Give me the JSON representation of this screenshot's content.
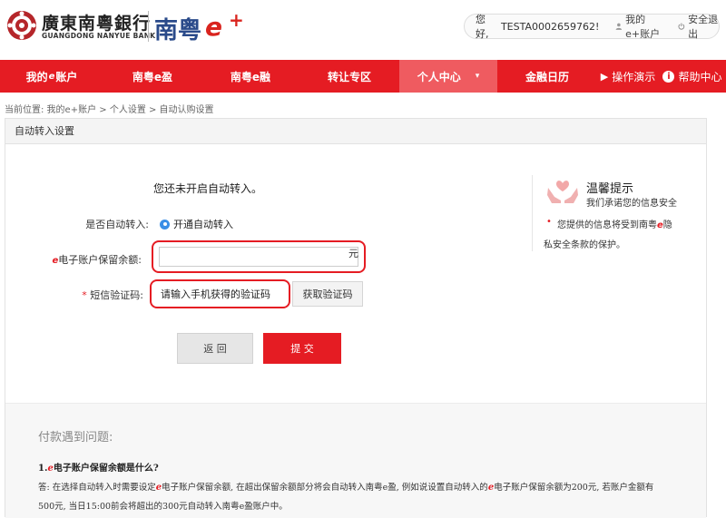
{
  "header": {
    "bank_name_cn": "廣東南粵銀行",
    "bank_name_en": "GUANGDONG NANYUE BANK",
    "brand_cn": "南粤",
    "brand_e": "e",
    "brand_plus": "+",
    "greeting": "您好,",
    "user_id": "TESTA0002659762!",
    "my_account": "我的e+账户",
    "logout": "安全退出"
  },
  "nav": {
    "items": [
      {
        "label": "我的",
        "suffix": "账户"
      },
      {
        "label": "南粤e盈"
      },
      {
        "label": "南粤e融"
      },
      {
        "label": "转让专区"
      },
      {
        "label": "个人中心",
        "caret": "▾"
      },
      {
        "label": "金融日历"
      },
      {
        "label": "操作演示",
        "icon": "▶"
      },
      {
        "label": "帮助中心",
        "icon": "i"
      }
    ]
  },
  "breadcrumb": "当前位置: 我的e+账户 > 个人设置 > 自动认购设置",
  "panel": {
    "title": "自动转入设置",
    "notice": "您还未开启自动转入。",
    "auto_label": "是否自动转入:",
    "auto_option": "开通自动转入",
    "balance_label": "电子账户保留余额:",
    "balance_value": "",
    "balance_unit": "元",
    "code_label": "短信验证码:",
    "code_placeholder": "请输入手机获得的验证码",
    "get_code_button": "获取验证码",
    "back_button": "返 回",
    "submit_button": "提 交"
  },
  "tips": {
    "title": "温馨提示",
    "subtitle": "我们承诺您的信息安全",
    "line1": "您提供的信息将受到南粤",
    "line1_tail": "隐",
    "line2": "私安全条款的保护。"
  },
  "faq": {
    "title": "付款遇到问题:",
    "q1_prefix": "1.",
    "q1": "电子账户保留余额是什么?",
    "a1_part1": "答: 在选择自动转入时需要设定",
    "a1_part2": "电子账户保留余额, 在超出保留余额部分将会自动转入南粤e盈, 例如说设置自动转入的",
    "a1_part3": "电子账户保留余额为200元, 若账户金额有",
    "a1_line2": "500元, 当日15:00前会将超出的300元自动转入南粤e盈账户中。"
  },
  "colors": {
    "brand_red": "#e51c23",
    "nav_active": "#ef5b60",
    "brand_blue": "#2a4a8a",
    "radio_blue": "#3a8ee6"
  }
}
